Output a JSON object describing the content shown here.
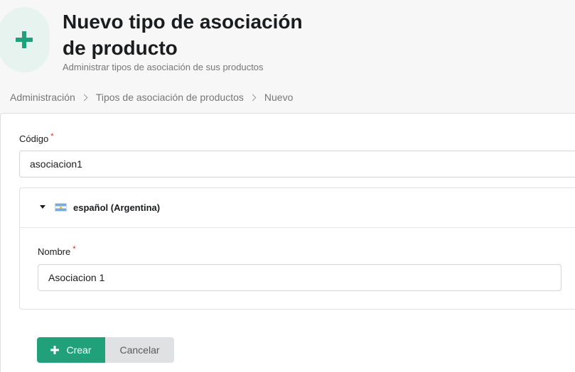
{
  "header": {
    "title": "Nuevo tipo de asociación de producto",
    "subtitle": "Administrar tipos de asociación de sus productos",
    "icon": "plus-icon"
  },
  "breadcrumb": {
    "items": [
      "Administración",
      "Tipos de asociación de productos",
      "Nuevo"
    ]
  },
  "form": {
    "code": {
      "label": "Código",
      "required_mark": "*",
      "value": "asociacion1"
    },
    "translations": {
      "locale": "español (Argentina)",
      "flag_icon": "argentina-flag-icon",
      "name": {
        "label": "Nombre",
        "required_mark": "*",
        "value": "Asociacion 1"
      }
    },
    "buttons": {
      "create_label": "Crear",
      "cancel_label": "Cancelar"
    }
  },
  "colors": {
    "accent": "#21a179",
    "icon_bg": "#e6f3ee",
    "required": "#db2828"
  }
}
